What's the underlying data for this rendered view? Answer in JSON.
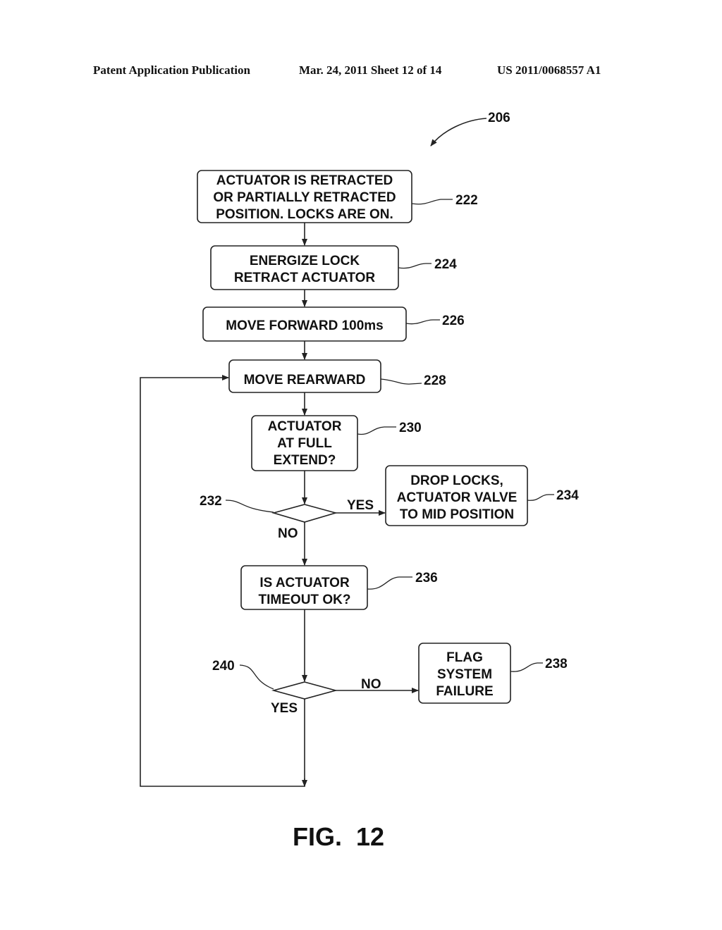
{
  "header": {
    "publication": "Patent Application Publication",
    "date_sheet": "Mar. 24, 2011  Sheet 12 of 14",
    "number": "US 2011/0068557 A1"
  },
  "figure": {
    "ref": "206",
    "caption": "FIG.  12"
  },
  "nodes": {
    "n222": {
      "ref": "222",
      "lines": [
        "ACTUATOR IS RETRACTED",
        "OR PARTIALLY RETRACTED",
        "POSITION. LOCKS ARE ON."
      ]
    },
    "n224": {
      "ref": "224",
      "lines": [
        "ENERGIZE LOCK",
        "RETRACT ACTUATOR"
      ]
    },
    "n226": {
      "ref": "226",
      "lines": [
        "MOVE FORWARD 100ms"
      ]
    },
    "n228": {
      "ref": "228",
      "lines": [
        "MOVE REARWARD"
      ]
    },
    "n230": {
      "ref": "230",
      "lines": [
        "ACTUATOR",
        "AT FULL",
        "EXTEND?"
      ]
    },
    "n232": {
      "ref": "232",
      "yes": "YES",
      "no": "NO"
    },
    "n234": {
      "ref": "234",
      "lines": [
        "DROP LOCKS,",
        "ACTUATOR VALVE",
        "TO MID POSITION"
      ]
    },
    "n236": {
      "ref": "236",
      "lines": [
        "IS ACTUATOR",
        "TIMEOUT OK?"
      ]
    },
    "n238": {
      "ref": "238",
      "lines": [
        "FLAG",
        "SYSTEM",
        "FAILURE"
      ]
    },
    "n240": {
      "ref": "240",
      "yes": "YES",
      "no": "NO"
    }
  }
}
